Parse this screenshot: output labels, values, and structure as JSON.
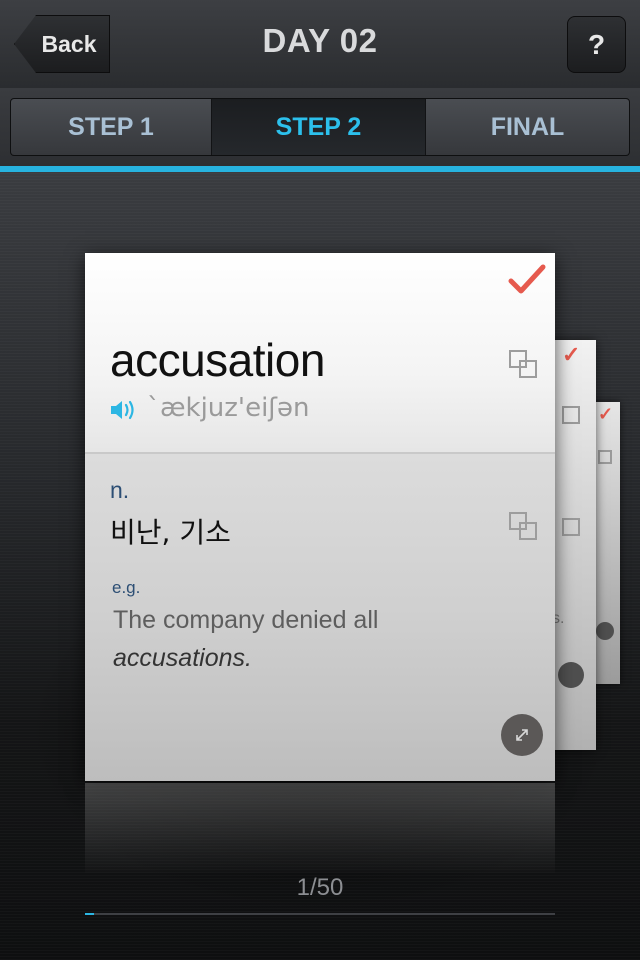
{
  "header": {
    "back_label": "Back",
    "title": "DAY 02",
    "help_label": "?"
  },
  "tabs": [
    {
      "label": "STEP 1",
      "active": false
    },
    {
      "label": "STEP 2",
      "active": true
    },
    {
      "label": "FINAL",
      "active": false
    }
  ],
  "card": {
    "word": "accusation",
    "pronunciation": "`ækjuz'eiʃən",
    "part_of_speech": "n.",
    "meaning": "비난, 기소",
    "example_label": "e.g.",
    "example_prefix": "The company denied all",
    "example_keyword": "accusations.",
    "checked": true
  },
  "back_card": {
    "snippet": "s."
  },
  "progress": {
    "current": "1",
    "separator": "/",
    "total": "50",
    "fraction": 0.02
  },
  "colors": {
    "accent": "#27b3df",
    "check": "#e65a4e",
    "pos_text": "#2c4e74"
  },
  "icons": {
    "speaker": "speaker-icon",
    "copy": "copy-icon",
    "check": "check-icon",
    "expand": "expand-icon"
  }
}
